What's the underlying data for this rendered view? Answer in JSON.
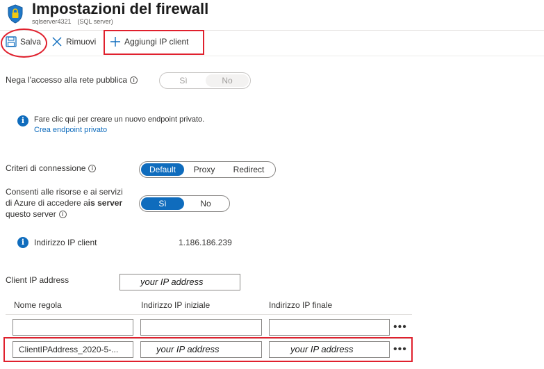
{
  "header": {
    "title": "Impostazioni del firewall",
    "server_name": "sqlserver4321",
    "server_kind": "(SQL server)",
    "icon": "shield-lock-icon"
  },
  "toolbar": {
    "save_label": "Salva",
    "remove_label": "Rimuovi",
    "add_client_ip_label": "Aggiungi IP client"
  },
  "public_access": {
    "label": "Nega l'accesso alla rete pubblica",
    "options": [
      "Sì",
      "No"
    ],
    "selected": "No"
  },
  "private_endpoint_info": {
    "text": "Fare clic qui per creare un nuovo endpoint privato.",
    "link": "Crea endpoint privato"
  },
  "connection_policy": {
    "label": "Criteri di connessione",
    "options": [
      "Default",
      "Proxy",
      "Redirect"
    ],
    "selected": "Default"
  },
  "allow_azure": {
    "label_line1": "Consenti alle risorse e ai servizi",
    "label_line2_a": "di Azure di accedere a",
    "label_line2_b": "is server",
    "label_line3": "questo server",
    "options": [
      "Sì",
      "No"
    ],
    "selected": "Sì"
  },
  "client_ip": {
    "label": "Indirizzo IP client",
    "value": "1.186.186.239"
  },
  "client_ip_address": {
    "label": "Client IP address",
    "value": "your IP address"
  },
  "rules_table": {
    "columns": [
      "Nome regola",
      "Indirizzo IP iniziale",
      "Indirizzo IP finale"
    ],
    "rows": [
      {
        "name": "",
        "start_ip": "",
        "end_ip": ""
      },
      {
        "name": "ClientIPAddress_2020-5-...",
        "start_ip": "your IP address",
        "end_ip": "your IP address"
      }
    ],
    "more_label": "•••"
  },
  "colors": {
    "accent": "#0f6cbd",
    "annotation_red": "#e0202d"
  }
}
